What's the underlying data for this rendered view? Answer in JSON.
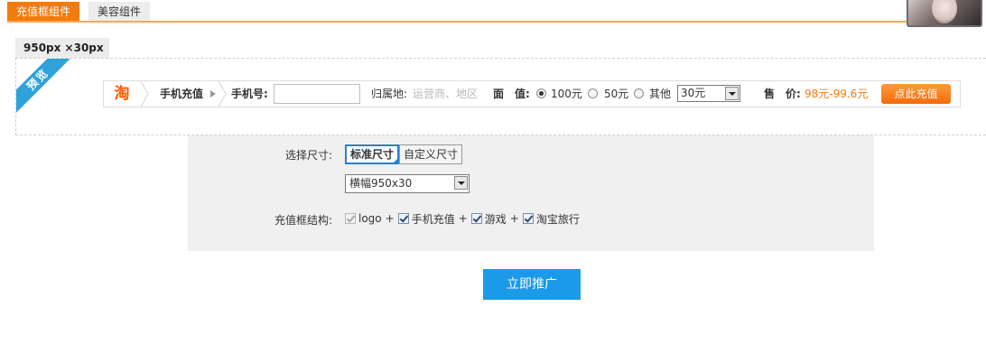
{
  "tabs": [
    {
      "label": "充值框组件",
      "active": true
    },
    {
      "label": "美容组件",
      "active": false
    }
  ],
  "size_tag": "950px ×30px",
  "preview": {
    "ribbon": "预览"
  },
  "bar": {
    "logo_char": "淘",
    "category": "手机充值",
    "phone_label": "手机号:",
    "phone_value": "",
    "region_label": "归属地:",
    "region_placeholder": "运营商、地区",
    "face_label": "面　值:",
    "face_options": [
      {
        "label": "100元",
        "checked": true
      },
      {
        "label": "50元",
        "checked": false
      },
      {
        "label": "其他",
        "checked": false
      }
    ],
    "amount_select": "30元",
    "price_label": "售　价:",
    "price_value": "98元-99.6元",
    "buy_button": "点此充值"
  },
  "settings": {
    "size_label": "选择尺寸:",
    "size_options": [
      {
        "label": "标准尺寸",
        "selected": true
      },
      {
        "label": "自定义尺寸",
        "selected": false
      }
    ],
    "size_select": "横幅950x30",
    "structure_label": "充值框结构:",
    "structure_items": [
      {
        "label": "logo",
        "checked": true,
        "disabled": true
      },
      {
        "label": "手机充值",
        "checked": true,
        "disabled": false
      },
      {
        "label": "游戏",
        "checked": true,
        "disabled": false
      },
      {
        "label": "淘宝旅行",
        "checked": true,
        "disabled": false
      }
    ],
    "plus_sign": "+"
  },
  "promote_button": "立即推广",
  "colors": {
    "accent_orange": "#f27b0e",
    "accent_blue": "#1a9ae8",
    "ribbon_blue": "#2fa2dc"
  }
}
